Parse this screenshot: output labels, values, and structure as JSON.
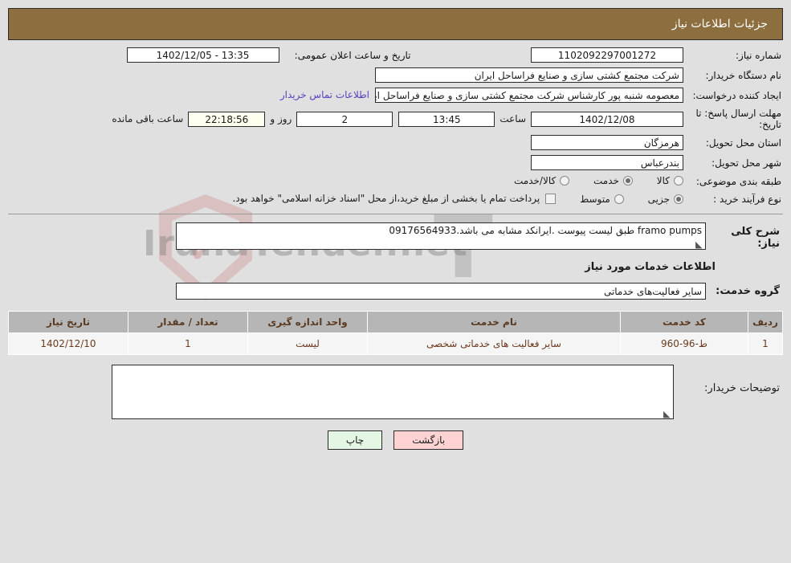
{
  "header": {
    "title": "جزئیات اطلاعات نیاز"
  },
  "form": {
    "need_number_label": "شماره نیاز:",
    "need_number_value": "1102092297001272",
    "announce_label": "تاریخ و ساعت اعلان عمومی:",
    "announce_value": "13:35 - 1402/12/05",
    "buyer_org_label": "نام دستگاه خریدار:",
    "buyer_org_value": "شرکت مجتمع کشتی سازی و صنایع فراساحل ایران",
    "creator_label": "ایجاد کننده درخواست:",
    "creator_value": "معصومه شنبه پور کارشناس شرکت مجتمع کشتی سازی و صنایع فراساحل ایران",
    "contact_link": "اطلاعات تماس خریدار",
    "deadline_label": "مهلت ارسال پاسخ: تا تاریخ:",
    "deadline_date": "1402/12/08",
    "hour_label": "ساعت",
    "deadline_time": "13:45",
    "days_value": "2",
    "days_label": "روز و",
    "countdown_value": "22:18:56",
    "remaining_label": "ساعت باقی مانده",
    "province_label": "استان محل تحویل:",
    "province_value": "هرمزگان",
    "city_label": "شهر محل تحویل:",
    "city_value": "بندرعباس",
    "category_label": "طبقه بندی موضوعی:",
    "category_options": [
      {
        "label": "کالا",
        "selected": false
      },
      {
        "label": "خدمت",
        "selected": true
      },
      {
        "label": "کالا/خدمت",
        "selected": false
      }
    ],
    "process_label": "نوع فرآیند خرید :",
    "process_options": [
      {
        "label": "جزیی",
        "selected": true
      },
      {
        "label": "متوسط",
        "selected": false
      }
    ],
    "treasury_checkbox_checked": false,
    "treasury_text": "پرداخت تمام یا بخشی از مبلغ خرید،از محل \"اسناد خزانه اسلامی\" خواهد بود."
  },
  "description": {
    "label": "شرح کلی نیاز:",
    "value": "framo pumps طبق لیست پیوست .ایرانکد مشابه می باشد.09176564933"
  },
  "services": {
    "section_title": "اطلاعات خدمات مورد نیاز",
    "group_label": "گروه خدمت:",
    "group_value": "سایر فعالیت‌های خدماتی",
    "columns": [
      "ردیف",
      "کد خدمت",
      "نام خدمت",
      "واحد اندازه گیری",
      "تعداد / مقدار",
      "تاریخ نیاز"
    ],
    "rows": [
      {
        "index": "1",
        "code": "ط-96-960",
        "name": "سایر فعالیت های خدماتی شخصی",
        "unit": "لیست",
        "quantity": "1",
        "need_date": "1402/12/10"
      }
    ]
  },
  "buyer_notes": {
    "label": "توضیحات خریدار:",
    "value": ""
  },
  "footer": {
    "back_label": "بازگشت",
    "print_label": "چاپ"
  },
  "watermark": {
    "brand": "IranaTender.net",
    "mark": "T"
  },
  "colors": {
    "header_brown": "#8d6e3f",
    "table_header_gray": "#b6b6b6",
    "table_text_brown": "#6b3a1e",
    "link_purple": "#5b3fbf",
    "back_pink": "#ffd3d3",
    "print_green": "#e4f6e4",
    "countdown_cream": "#fffff0"
  }
}
